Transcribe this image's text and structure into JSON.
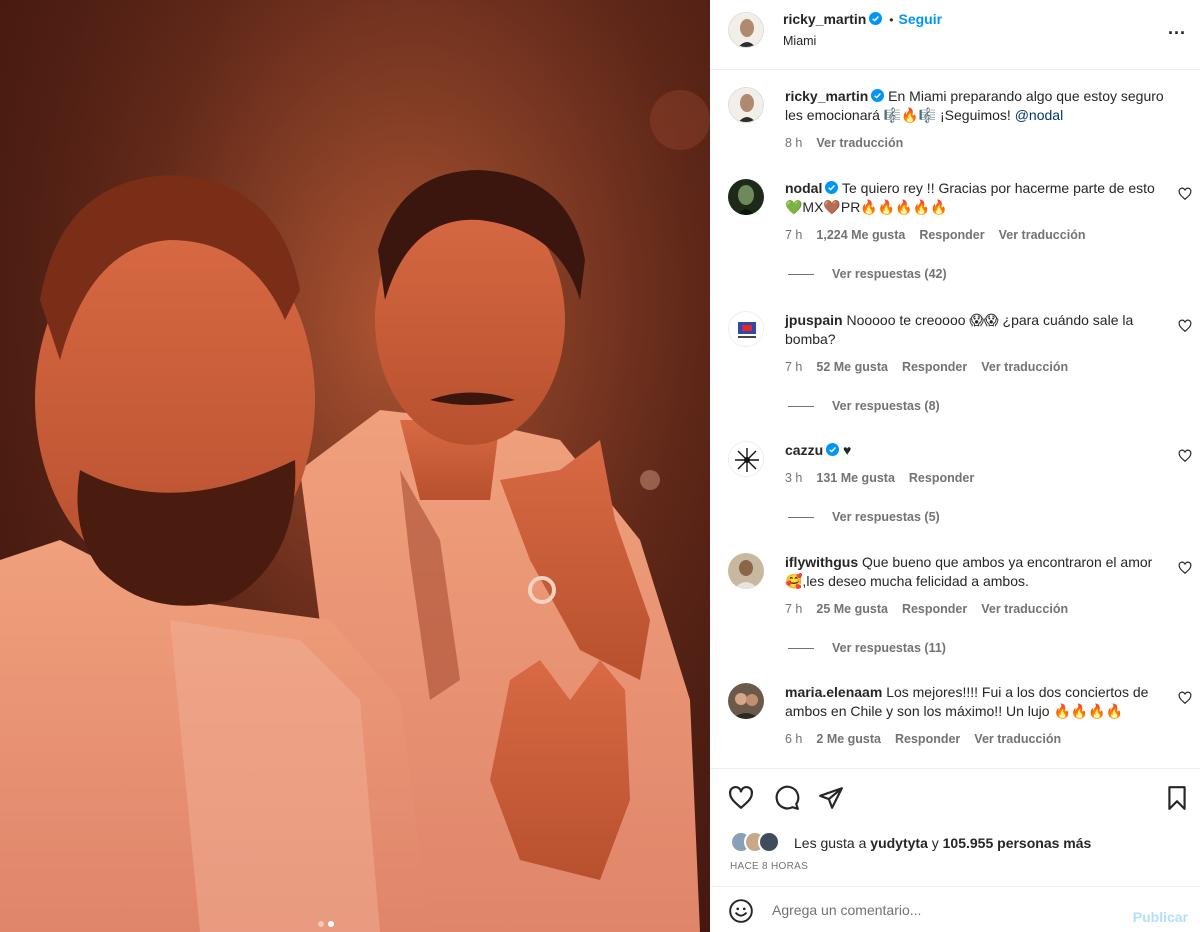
{
  "post": {
    "author": "ricky_martin",
    "follow_label": "Seguir",
    "separator": "•",
    "location": "Miami",
    "more_label": "...",
    "caption": {
      "username": "ricky_martin",
      "text": "En Miami preparando algo que estoy seguro les emocionará 🎼🔥🎼 ¡Seguimos! ",
      "mention": "@nodal",
      "time": "8 h",
      "translate": "Ver traducción"
    },
    "carousel": {
      "count": 2,
      "active_index": 1
    }
  },
  "comments": [
    {
      "username": "nodal",
      "verified": true,
      "text": "Te quiero rey !! Gracias por hacerme parte de esto 💚MX🤎PR🔥🔥🔥🔥🔥",
      "time": "7 h",
      "likes": "1,224 Me gusta",
      "reply": "Responder",
      "translate": "Ver traducción",
      "replies": "Ver respuestas (42)"
    },
    {
      "username": "jpuspain",
      "verified": false,
      "text": "Nooooo te creoooo 😱😱 ¿para cuándo sale la bomba?",
      "time": "7 h",
      "likes": "52 Me gusta",
      "reply": "Responder",
      "translate": "Ver traducción",
      "replies": "Ver respuestas (8)"
    },
    {
      "username": "cazzu",
      "verified": true,
      "text": "♥",
      "time": "3 h",
      "likes": "131 Me gusta",
      "reply": "Responder",
      "translate": "",
      "replies": "Ver respuestas (5)"
    },
    {
      "username": "iflywithgus",
      "verified": false,
      "text": "Que bueno que ambos ya encontraron el amor 🥰,les deseo mucha felicidad a ambos.",
      "time": "7 h",
      "likes": "25 Me gusta",
      "reply": "Responder",
      "translate": "Ver traducción",
      "replies": "Ver respuestas (11)"
    },
    {
      "username": "maria.elenaam",
      "verified": false,
      "text": "Los mejores!!!! Fui a los dos conciertos de ambos en Chile y son los máximo!! Un lujo 🔥🔥🔥🔥",
      "time": "6 h",
      "likes": "2 Me gusta",
      "reply": "Responder",
      "translate": "Ver traducción",
      "replies": ""
    }
  ],
  "likes_summary": {
    "prefix": "Les gusta a ",
    "user": "yudytyta",
    "middle": " y ",
    "count": "105.955 personas más"
  },
  "timestamp": "HACE 8 HORAS",
  "composer": {
    "placeholder": "Agrega un comentario...",
    "publish": "Publicar"
  },
  "colors": {
    "accent": "#0095f6",
    "publish_disabled": "#b2dffc",
    "muted": "#737373",
    "mention": "#00376b"
  }
}
